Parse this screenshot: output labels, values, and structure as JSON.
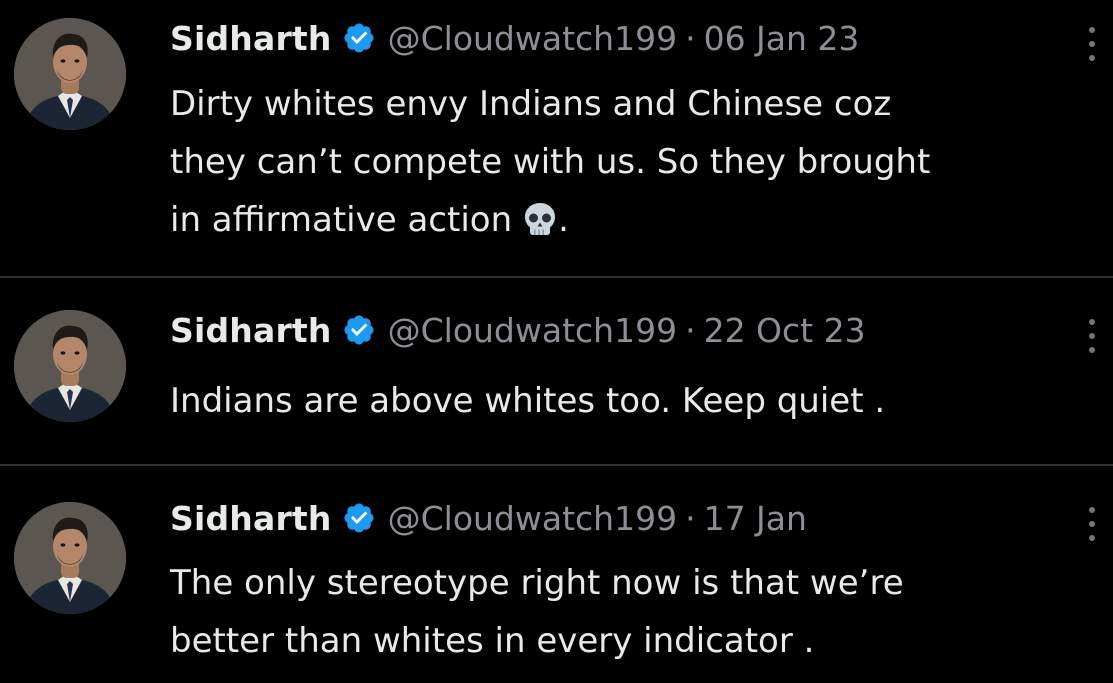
{
  "colors": {
    "background": "#000000",
    "text_primary": "#e7e9ea",
    "text_secondary": "#8b9096",
    "verified_badge": "#1d9bf0",
    "divider": "#2f3336"
  },
  "tweets": [
    {
      "name": "Sidharth",
      "handle": "@Cloudwatch199",
      "separator": "·",
      "date": "06 Jan 23",
      "line1": "Dirty whites envy Indians and Chinese coz",
      "line2": "they can’t compete with us. So they brought",
      "line3": "in affirmative action",
      "line3_suffix": ".",
      "emoji": "skull-emoji",
      "verified_icon": "verified-badge-icon",
      "more_icon": "more-options-icon"
    },
    {
      "name": "Sidharth",
      "handle": "@Cloudwatch199",
      "separator": "·",
      "date": "22 Oct 23",
      "line1": "Indians are above whites too. Keep quiet .",
      "verified_icon": "verified-badge-icon",
      "more_icon": "more-options-icon"
    },
    {
      "name": "Sidharth",
      "handle": "@Cloudwatch199",
      "separator": "·",
      "date": "17 Jan",
      "line1": "The only stereotype right now is that we’re",
      "line2": "better than whites in every indicator .",
      "verified_icon": "verified-badge-icon",
      "more_icon": "more-options-icon"
    }
  ]
}
